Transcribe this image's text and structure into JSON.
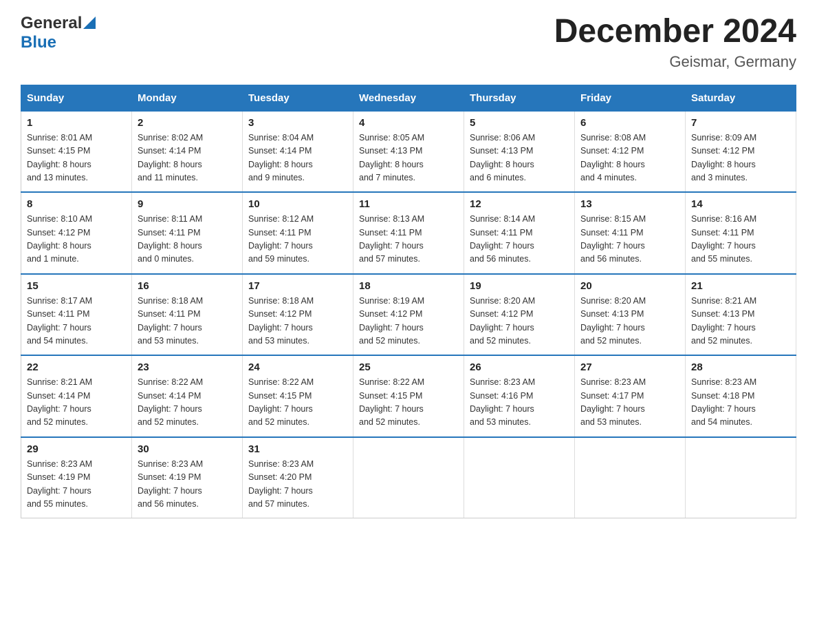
{
  "header": {
    "logo_general": "General",
    "logo_blue": "Blue",
    "title": "December 2024",
    "subtitle": "Geismar, Germany"
  },
  "weekdays": [
    "Sunday",
    "Monday",
    "Tuesday",
    "Wednesday",
    "Thursday",
    "Friday",
    "Saturday"
  ],
  "weeks": [
    [
      {
        "day": "1",
        "info": "Sunrise: 8:01 AM\nSunset: 4:15 PM\nDaylight: 8 hours\nand 13 minutes."
      },
      {
        "day": "2",
        "info": "Sunrise: 8:02 AM\nSunset: 4:14 PM\nDaylight: 8 hours\nand 11 minutes."
      },
      {
        "day": "3",
        "info": "Sunrise: 8:04 AM\nSunset: 4:14 PM\nDaylight: 8 hours\nand 9 minutes."
      },
      {
        "day": "4",
        "info": "Sunrise: 8:05 AM\nSunset: 4:13 PM\nDaylight: 8 hours\nand 7 minutes."
      },
      {
        "day": "5",
        "info": "Sunrise: 8:06 AM\nSunset: 4:13 PM\nDaylight: 8 hours\nand 6 minutes."
      },
      {
        "day": "6",
        "info": "Sunrise: 8:08 AM\nSunset: 4:12 PM\nDaylight: 8 hours\nand 4 minutes."
      },
      {
        "day": "7",
        "info": "Sunrise: 8:09 AM\nSunset: 4:12 PM\nDaylight: 8 hours\nand 3 minutes."
      }
    ],
    [
      {
        "day": "8",
        "info": "Sunrise: 8:10 AM\nSunset: 4:12 PM\nDaylight: 8 hours\nand 1 minute."
      },
      {
        "day": "9",
        "info": "Sunrise: 8:11 AM\nSunset: 4:11 PM\nDaylight: 8 hours\nand 0 minutes."
      },
      {
        "day": "10",
        "info": "Sunrise: 8:12 AM\nSunset: 4:11 PM\nDaylight: 7 hours\nand 59 minutes."
      },
      {
        "day": "11",
        "info": "Sunrise: 8:13 AM\nSunset: 4:11 PM\nDaylight: 7 hours\nand 57 minutes."
      },
      {
        "day": "12",
        "info": "Sunrise: 8:14 AM\nSunset: 4:11 PM\nDaylight: 7 hours\nand 56 minutes."
      },
      {
        "day": "13",
        "info": "Sunrise: 8:15 AM\nSunset: 4:11 PM\nDaylight: 7 hours\nand 56 minutes."
      },
      {
        "day": "14",
        "info": "Sunrise: 8:16 AM\nSunset: 4:11 PM\nDaylight: 7 hours\nand 55 minutes."
      }
    ],
    [
      {
        "day": "15",
        "info": "Sunrise: 8:17 AM\nSunset: 4:11 PM\nDaylight: 7 hours\nand 54 minutes."
      },
      {
        "day": "16",
        "info": "Sunrise: 8:18 AM\nSunset: 4:11 PM\nDaylight: 7 hours\nand 53 minutes."
      },
      {
        "day": "17",
        "info": "Sunrise: 8:18 AM\nSunset: 4:12 PM\nDaylight: 7 hours\nand 53 minutes."
      },
      {
        "day": "18",
        "info": "Sunrise: 8:19 AM\nSunset: 4:12 PM\nDaylight: 7 hours\nand 52 minutes."
      },
      {
        "day": "19",
        "info": "Sunrise: 8:20 AM\nSunset: 4:12 PM\nDaylight: 7 hours\nand 52 minutes."
      },
      {
        "day": "20",
        "info": "Sunrise: 8:20 AM\nSunset: 4:13 PM\nDaylight: 7 hours\nand 52 minutes."
      },
      {
        "day": "21",
        "info": "Sunrise: 8:21 AM\nSunset: 4:13 PM\nDaylight: 7 hours\nand 52 minutes."
      }
    ],
    [
      {
        "day": "22",
        "info": "Sunrise: 8:21 AM\nSunset: 4:14 PM\nDaylight: 7 hours\nand 52 minutes."
      },
      {
        "day": "23",
        "info": "Sunrise: 8:22 AM\nSunset: 4:14 PM\nDaylight: 7 hours\nand 52 minutes."
      },
      {
        "day": "24",
        "info": "Sunrise: 8:22 AM\nSunset: 4:15 PM\nDaylight: 7 hours\nand 52 minutes."
      },
      {
        "day": "25",
        "info": "Sunrise: 8:22 AM\nSunset: 4:15 PM\nDaylight: 7 hours\nand 52 minutes."
      },
      {
        "day": "26",
        "info": "Sunrise: 8:23 AM\nSunset: 4:16 PM\nDaylight: 7 hours\nand 53 minutes."
      },
      {
        "day": "27",
        "info": "Sunrise: 8:23 AM\nSunset: 4:17 PM\nDaylight: 7 hours\nand 53 minutes."
      },
      {
        "day": "28",
        "info": "Sunrise: 8:23 AM\nSunset: 4:18 PM\nDaylight: 7 hours\nand 54 minutes."
      }
    ],
    [
      {
        "day": "29",
        "info": "Sunrise: 8:23 AM\nSunset: 4:19 PM\nDaylight: 7 hours\nand 55 minutes."
      },
      {
        "day": "30",
        "info": "Sunrise: 8:23 AM\nSunset: 4:19 PM\nDaylight: 7 hours\nand 56 minutes."
      },
      {
        "day": "31",
        "info": "Sunrise: 8:23 AM\nSunset: 4:20 PM\nDaylight: 7 hours\nand 57 minutes."
      },
      {
        "day": "",
        "info": ""
      },
      {
        "day": "",
        "info": ""
      },
      {
        "day": "",
        "info": ""
      },
      {
        "day": "",
        "info": ""
      }
    ]
  ]
}
